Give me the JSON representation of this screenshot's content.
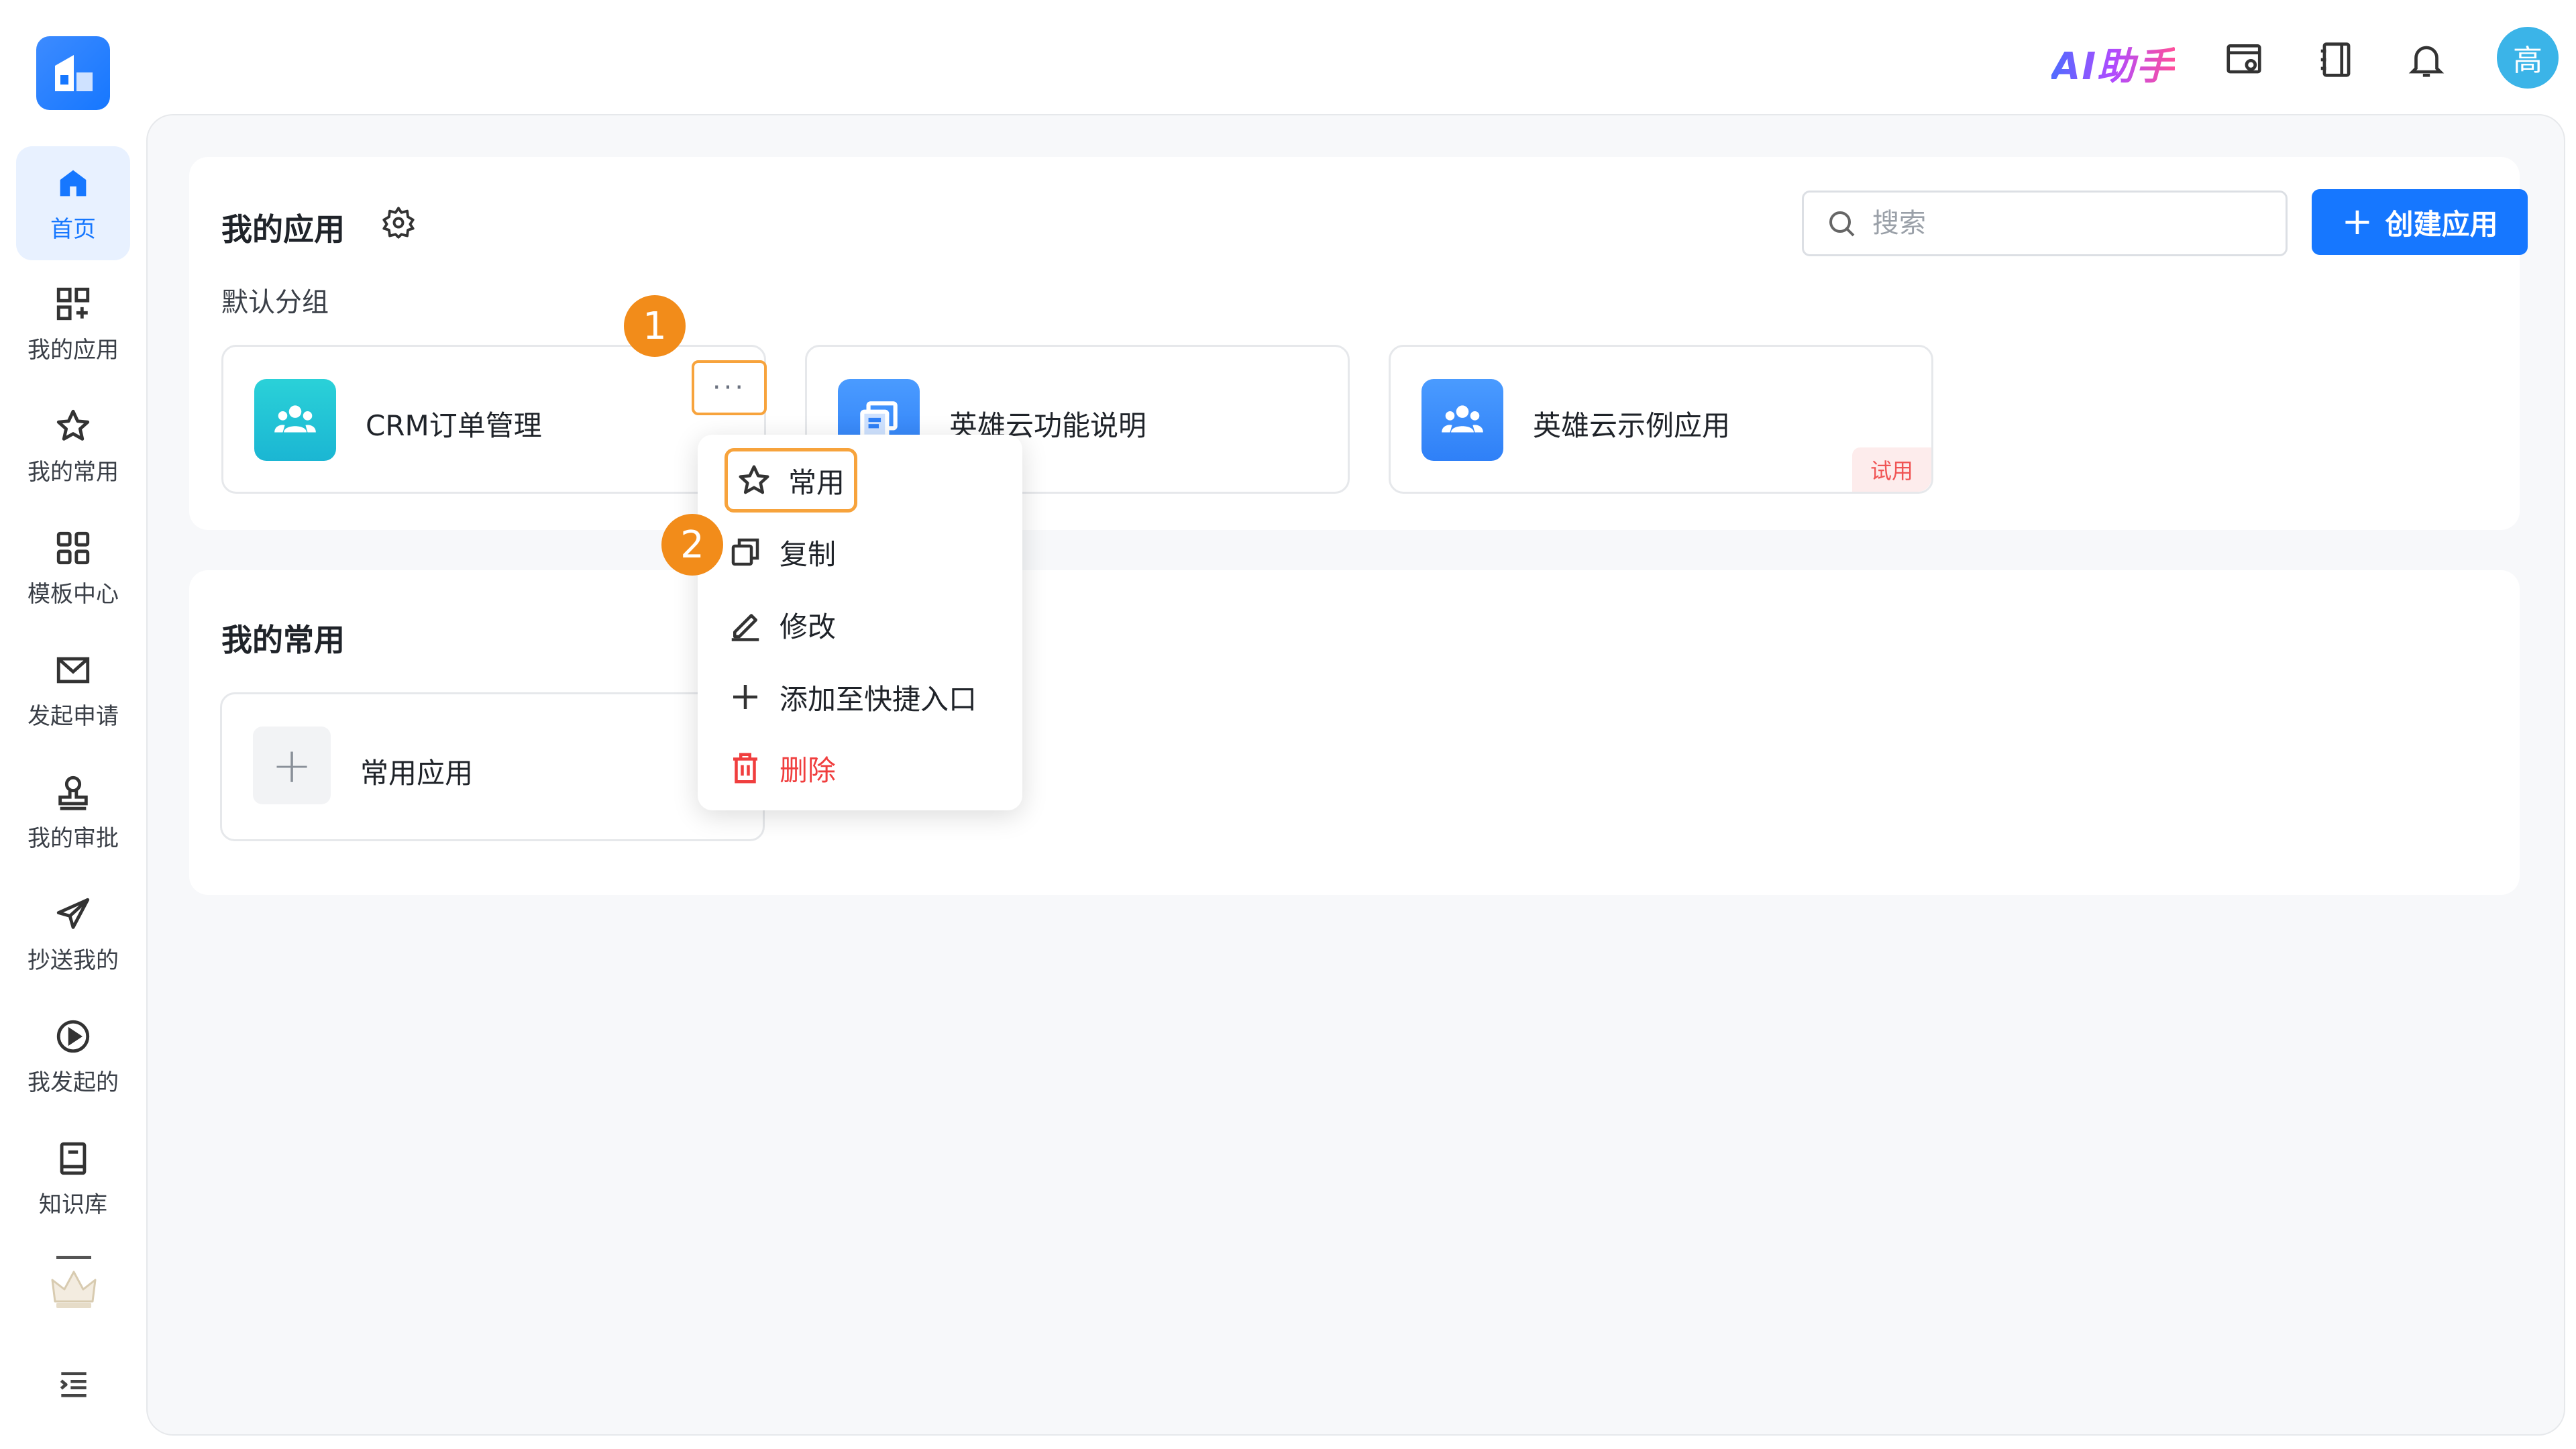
{
  "header": {
    "ai_label": "AI助手",
    "avatar_text": "高"
  },
  "sidebar": {
    "items": [
      {
        "label": "首页",
        "icon": "home-icon"
      },
      {
        "label": "我的应用",
        "icon": "apps-grid-plus-icon"
      },
      {
        "label": "我的常用",
        "icon": "star-icon"
      },
      {
        "label": "模板中心",
        "icon": "template-grid-icon"
      },
      {
        "label": "发起申请",
        "icon": "mail-icon"
      },
      {
        "label": "我的审批",
        "icon": "stamp-icon"
      },
      {
        "label": "抄送我的",
        "icon": "send-icon"
      },
      {
        "label": "我发起的",
        "icon": "play-circle-icon"
      },
      {
        "label": "知识库",
        "icon": "book-icon"
      }
    ]
  },
  "apps_section": {
    "title": "我的应用",
    "group_label": "默认分组",
    "search_placeholder": "搜索",
    "create_label": "创建应用",
    "apps": [
      {
        "name": "CRM订单管理",
        "icon": "team-icon",
        "color": "#21c6d8"
      },
      {
        "name": "英雄云功能说明",
        "icon": "document-icon",
        "color": "#3b8cff"
      },
      {
        "name": "英雄云示例应用",
        "icon": "team-icon",
        "color": "#3b8cff",
        "tag": "试用"
      }
    ]
  },
  "fav_section": {
    "title": "我的常用",
    "add_label": "常用应用"
  },
  "context_menu": {
    "items": [
      {
        "label": "常用",
        "icon": "star-outline-icon"
      },
      {
        "label": "复制",
        "icon": "copy-icon"
      },
      {
        "label": "修改",
        "icon": "edit-icon"
      },
      {
        "label": "添加至快捷入口",
        "icon": "plus-icon"
      },
      {
        "label": "删除",
        "icon": "trash-icon"
      }
    ]
  },
  "steps": [
    "1",
    "2"
  ],
  "colors": {
    "primary": "#1677ff",
    "highlight": "#f7a33c",
    "step_badge": "#f28c1a",
    "danger": "#f03e3e"
  }
}
